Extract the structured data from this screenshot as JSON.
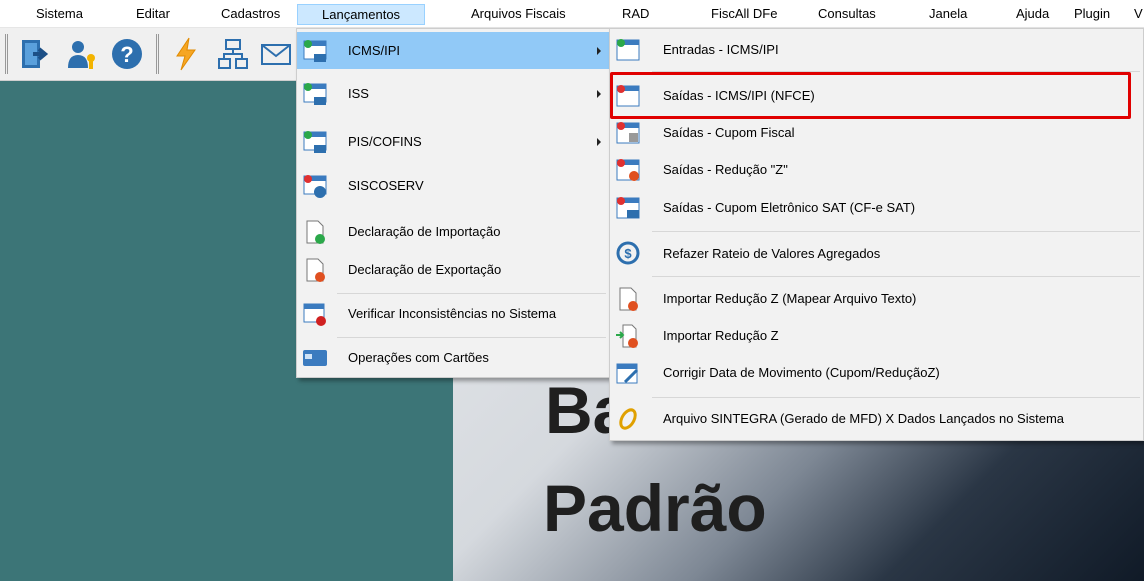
{
  "menubar": {
    "items": [
      "Sistema",
      "Editar",
      "Cadastros",
      "Lançamentos",
      "Arquivos Fiscais",
      "RAD",
      "FiscAll DFe",
      "Consultas",
      "Janela",
      "Ajuda",
      "Plugin",
      "V"
    ]
  },
  "toolbar": {
    "buttons": [
      "exit-icon",
      "users-key-icon",
      "help-icon",
      "lightning-icon",
      "org-chart-icon",
      "envelope-icon"
    ]
  },
  "background": {
    "line1": "Ba",
    "line2": "Padrão"
  },
  "lancamentos_menu": {
    "items": [
      {
        "label": "ICMS/IPI",
        "icon": "table-icms-icon",
        "submenu": true,
        "highlighted": true
      },
      {
        "label": "ISS",
        "icon": "table-iss-icon",
        "submenu": true
      },
      {
        "label": "PIS/COFINS",
        "icon": "table-pis-icon",
        "submenu": true
      },
      {
        "label": "SISCOSERV",
        "icon": "table-siscoserv-icon",
        "submenu": false
      },
      {
        "label": "Declaração de Importação",
        "icon": "doc-import-icon"
      },
      {
        "label": "Declaração de Exportação",
        "icon": "doc-export-icon"
      },
      {
        "label": "Verificar Inconsistências no Sistema",
        "icon": "warning-window-icon"
      },
      {
        "label": "Operações com Cartões",
        "icon": "card-icon"
      }
    ]
  },
  "icms_submenu": {
    "items": [
      {
        "label": "Entradas - ICMS/IPI",
        "icon": "table-entry-icon"
      },
      {
        "label": "Saídas - ICMS/IPI (NFCE)",
        "icon": "table-exit-icon",
        "boxed": true
      },
      {
        "label": "Saídas - Cupom Fiscal",
        "icon": "table-coupon-icon"
      },
      {
        "label": "Saídas - Redução \"Z\"",
        "icon": "table-z-icon"
      },
      {
        "label": "Saídas - Cupom Eletrônico SAT (CF-e SAT)",
        "icon": "table-sat-icon"
      },
      {
        "label": "Refazer Rateio de Valores Agregados",
        "icon": "dollar-refresh-icon"
      },
      {
        "label": "Importar Redução Z (Mapear Arquivo Texto)",
        "icon": "doc-z-icon"
      },
      {
        "label": "Importar Redução Z",
        "icon": "import-z-icon"
      },
      {
        "label": "Corrigir Data de Movimento (Cupom/ReduçãoZ)",
        "icon": "calendar-edit-icon"
      },
      {
        "label": "Arquivo SINTEGRA (Gerado de MFD) X Dados Lançados no Sistema",
        "icon": "sintegra-icon"
      }
    ]
  },
  "colors": {
    "desktop": "#3c7577",
    "menu_highlight": "#91c9f7",
    "red_box": "#e00000"
  }
}
